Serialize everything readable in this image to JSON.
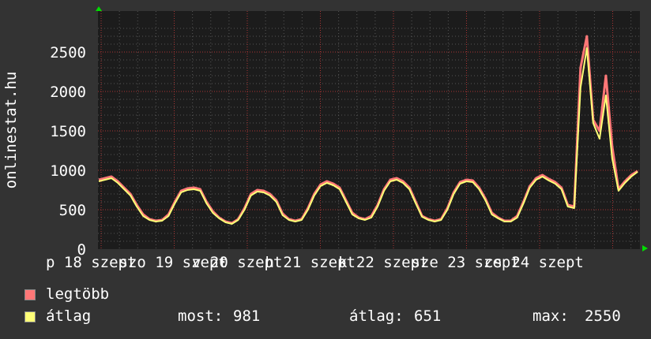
{
  "chart_data": {
    "type": "line",
    "ylabel": "onlinestat.hu",
    "ylim": [
      0,
      2800
    ],
    "y_ticks": [
      0,
      500,
      1000,
      1500,
      2000,
      2500
    ],
    "x_tick_labels": [
      "p 18 szept",
      "szo 19 szept",
      "v 20 szept",
      "h 21 szept",
      "k 22 szept",
      "sze 23 szept",
      "cs 24 szept"
    ],
    "grid": true,
    "series": [
      {
        "name": "legtöbb",
        "color": "#ff7777",
        "values": [
          880,
          900,
          920,
          860,
          780,
          700,
          560,
          440,
          380,
          360,
          370,
          440,
          600,
          740,
          770,
          780,
          760,
          600,
          480,
          400,
          350,
          330,
          380,
          520,
          700,
          750,
          740,
          700,
          620,
          450,
          380,
          360,
          380,
          520,
          700,
          820,
          860,
          830,
          780,
          620,
          460,
          400,
          380,
          420,
          560,
          760,
          880,
          900,
          860,
          780,
          600,
          420,
          380,
          360,
          380,
          520,
          720,
          850,
          880,
          870,
          780,
          640,
          460,
          400,
          360,
          360,
          420,
          600,
          800,
          900,
          940,
          890,
          850,
          780,
          560,
          540,
          2300,
          2700,
          1640,
          1500,
          2200,
          1300,
          760,
          860,
          940,
          990
        ]
      },
      {
        "name": "átlag",
        "color": "#ffff77",
        "values": [
          860,
          880,
          900,
          840,
          760,
          680,
          540,
          420,
          370,
          350,
          360,
          420,
          580,
          720,
          750,
          760,
          740,
          580,
          460,
          390,
          340,
          320,
          370,
          500,
          680,
          730,
          720,
          680,
          600,
          430,
          370,
          350,
          370,
          500,
          680,
          800,
          840,
          810,
          760,
          600,
          440,
          390,
          370,
          400,
          540,
          740,
          860,
          880,
          840,
          760,
          580,
          410,
          370,
          350,
          370,
          500,
          700,
          830,
          860,
          850,
          760,
          620,
          440,
          390,
          350,
          350,
          400,
          580,
          780,
          880,
          920,
          870,
          830,
          760,
          540,
          520,
          2050,
          2550,
          1600,
          1400,
          1950,
          1150,
          740,
          840,
          920,
          981
        ]
      }
    ],
    "stats": {
      "most_label": "most:",
      "most": "981",
      "atlag_label": "átlag:",
      "atlag": "651",
      "max_label": "max:",
      "max": "2550"
    },
    "colors": {
      "background": "#333333",
      "plot": "#1c1c1c",
      "grid": "#555555",
      "gridmajor": "#aa3333"
    }
  }
}
